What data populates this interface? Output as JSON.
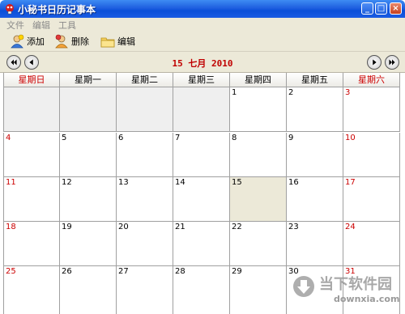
{
  "window": {
    "title": "小秘书日历记事本"
  },
  "menu": {
    "items": [
      "文件",
      "编辑",
      "工具"
    ]
  },
  "toolbar": {
    "add_label": "添加",
    "delete_label": "删除",
    "edit_label": "编辑"
  },
  "nav": {
    "title": "15 七月 2010"
  },
  "calendar": {
    "weekdays": [
      "星期日",
      "星期一",
      "星期二",
      "星期三",
      "星期四",
      "星期五",
      "星期六"
    ],
    "weeks": [
      [
        "",
        "",
        "",
        "",
        "1",
        "2",
        "3"
      ],
      [
        "4",
        "5",
        "6",
        "7",
        "8",
        "9",
        "10"
      ],
      [
        "11",
        "12",
        "13",
        "14",
        "15",
        "16",
        "17"
      ],
      [
        "18",
        "19",
        "20",
        "21",
        "22",
        "23",
        "24"
      ],
      [
        "25",
        "26",
        "27",
        "28",
        "29",
        "30",
        "31"
      ]
    ],
    "today": "15"
  },
  "watermark": {
    "text": "当下软件园",
    "sub": "downxia.com"
  },
  "colors": {
    "titlebar": "#0b4fd8",
    "weekend": "#cc0000",
    "today_bg": "#ece9d8",
    "chrome": "#ece9d8"
  }
}
